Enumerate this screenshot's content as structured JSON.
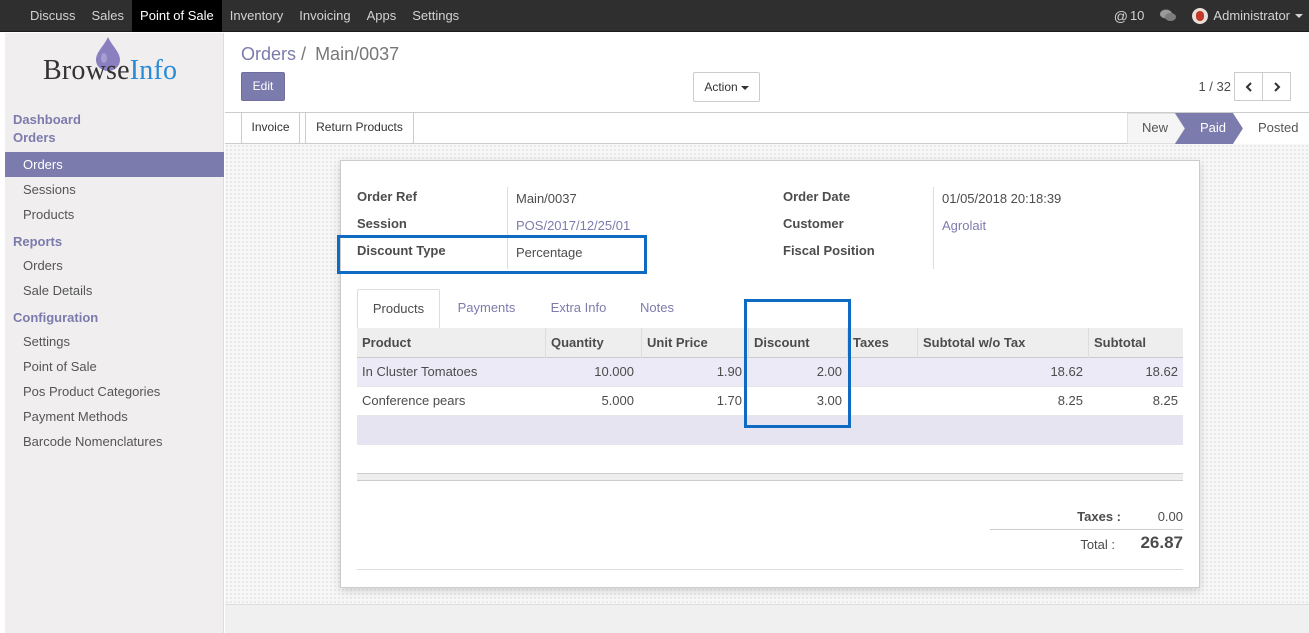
{
  "topnav": {
    "items": [
      "Discuss",
      "Sales",
      "Point of Sale",
      "Inventory",
      "Invoicing",
      "Apps",
      "Settings"
    ],
    "active_index": 2,
    "mentions_count": "10",
    "user": "Administrator"
  },
  "sidebar": {
    "logo_text_a": "Browse",
    "logo_text_b": "Info",
    "sections": [
      {
        "title": "Dashboard",
        "items": []
      },
      {
        "title": "Orders",
        "items": [
          "Orders",
          "Sessions",
          "Products"
        ]
      },
      {
        "title": "Reports",
        "items": [
          "Orders",
          "Sale Details"
        ]
      },
      {
        "title": "Configuration",
        "items": [
          "Settings",
          "Point of Sale",
          "Pos Product Categories",
          "Payment Methods",
          "Barcode Nomenclatures"
        ]
      }
    ],
    "active_item": "Orders"
  },
  "control_panel": {
    "breadcrumb_parent": "Orders",
    "breadcrumb_sep": "/",
    "breadcrumb_current": "Main/0037",
    "edit_label": "Edit",
    "action_label": "Action",
    "pager": "1 / 32"
  },
  "statusbar": {
    "invoice_label": "Invoice",
    "return_label": "Return Products",
    "stages": [
      "New",
      "Paid",
      "Posted"
    ],
    "active_stage": "Paid"
  },
  "form": {
    "order_ref_label": "Order Ref",
    "order_ref": "Main/0037",
    "session_label": "Session",
    "session": "POS/2017/12/25/01",
    "discount_type_label": "Discount Type",
    "discount_type": "Percentage",
    "order_date_label": "Order Date",
    "order_date": "01/05/2018 20:18:39",
    "customer_label": "Customer",
    "customer": "Agrolait",
    "fiscal_position_label": "Fiscal Position",
    "fiscal_position": ""
  },
  "tabs": [
    "Products",
    "Payments",
    "Extra Info",
    "Notes"
  ],
  "table": {
    "columns": [
      "Product",
      "Quantity",
      "Unit Price",
      "Discount",
      "Taxes",
      "Subtotal w/o Tax",
      "Subtotal"
    ],
    "rows": [
      {
        "product": "In Cluster Tomatoes",
        "quantity": "10.000",
        "unit_price": "1.90",
        "discount": "2.00",
        "taxes": "",
        "subtotal_wo_tax": "18.62",
        "subtotal": "18.62"
      },
      {
        "product": "Conference pears",
        "quantity": "5.000",
        "unit_price": "1.70",
        "discount": "3.00",
        "taxes": "",
        "subtotal_wo_tax": "8.25",
        "subtotal": "8.25"
      }
    ]
  },
  "totals": {
    "taxes_label": "Taxes :",
    "taxes": "0.00",
    "total_label": "Total :",
    "total": "26.87"
  },
  "colors": {
    "accent": "#7c7bad",
    "highlight_box": "#0f6ac2",
    "topbar": "#2f2f2f"
  }
}
